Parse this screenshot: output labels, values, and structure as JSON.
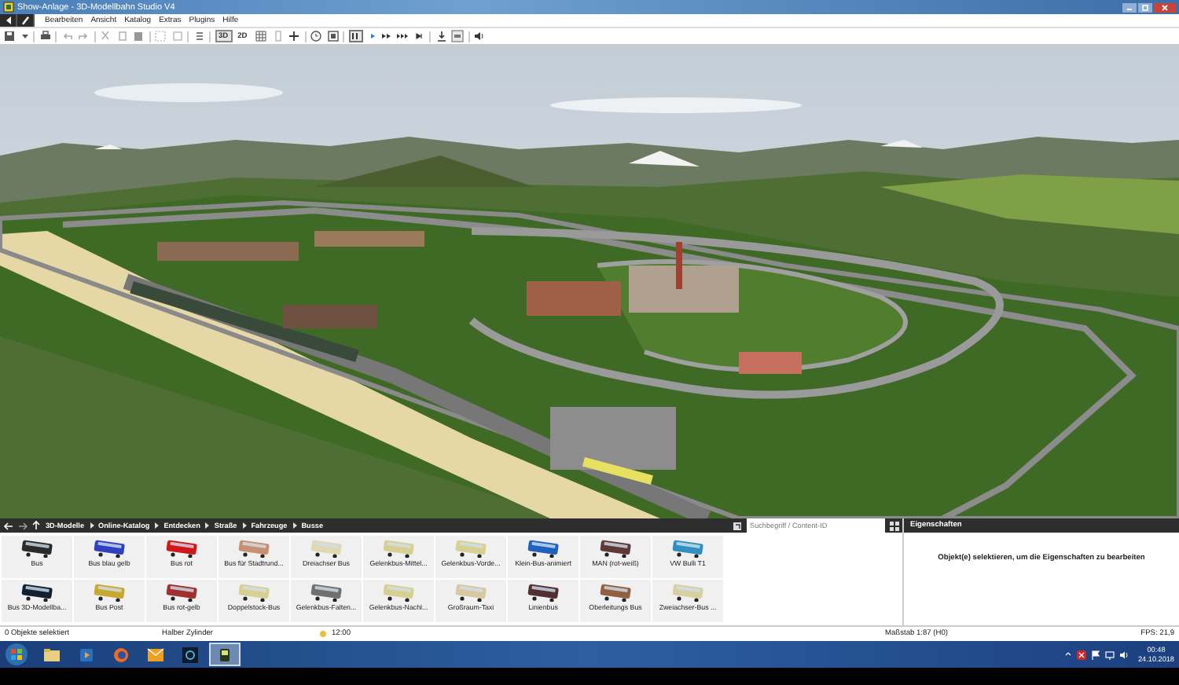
{
  "window": {
    "title": "Show-Anlage - 3D-Modellbahn Studio V4"
  },
  "menu": [
    "Bearbeiten",
    "Ansicht",
    "Katalog",
    "Extras",
    "Plugins",
    "Hilfe"
  ],
  "toolbar": {
    "view_modes": [
      {
        "label": "3D",
        "selected": true
      },
      {
        "label": "2D",
        "selected": false
      }
    ],
    "paused": true
  },
  "catalog": {
    "breadcrumb": [
      "3D-Modelle",
      "Online-Katalog",
      "Entdecken",
      "Straße",
      "Fahrzeuge",
      "Busse"
    ],
    "search": {
      "placeholder": "Suchbegriff / Content-ID"
    },
    "items": [
      {
        "label": "Bus",
        "color": "#2a2a2a"
      },
      {
        "label": "Bus blau gelb",
        "color": "#3040c0"
      },
      {
        "label": "Bus rot",
        "color": "#d01818"
      },
      {
        "label": "Bus für Stadtrund...",
        "color": "#c89070"
      },
      {
        "label": "Dreiachser Bus",
        "color": "#e0d8b0"
      },
      {
        "label": "Gelenkbus-Mittel...",
        "color": "#d8d090"
      },
      {
        "label": "Gelenkbus-Vorde...",
        "color": "#d8d090"
      },
      {
        "label": "Klein-Bus-animiert",
        "color": "#2060c0"
      },
      {
        "label": "MAN (rot-weiß)",
        "color": "#603838"
      },
      {
        "label": "VW Bulli T1",
        "color": "#3090c0"
      },
      {
        "label": "Bus 3D-Modellba...",
        "color": "#102030"
      },
      {
        "label": "Bus Post",
        "color": "#c8a830"
      },
      {
        "label": "Bus rot-gelb",
        "color": "#a03030"
      },
      {
        "label": "Doppelstock-Bus",
        "color": "#d8d090"
      },
      {
        "label": "Gelenkbus-Falten...",
        "color": "#707070"
      },
      {
        "label": "Gelenkbus-Nachl...",
        "color": "#d8d090"
      },
      {
        "label": "Großraum-Taxi",
        "color": "#d8c8a0"
      },
      {
        "label": "Linienbus",
        "color": "#503030"
      },
      {
        "label": "Oberleitungs Bus",
        "color": "#906040"
      },
      {
        "label": "Zweiachser-Bus ...",
        "color": "#d8d0a0"
      }
    ]
  },
  "properties": {
    "title": "Eigenschaften",
    "message": "Objekt(e) selektieren, um die Eigenschaften zu bearbeiten"
  },
  "status_bar": {
    "selection": "0 Objekte selektiert",
    "tool": "Halber Zylinder",
    "time": "12:00",
    "scale": "Maßstab 1:87 (H0)",
    "fps": "FPS: 21,9"
  },
  "taskbar": {
    "apps": [
      {
        "selected": false
      },
      {
        "selected": false
      },
      {
        "selected": false
      },
      {
        "selected": false
      },
      {
        "selected": false
      },
      {
        "selected": true
      }
    ],
    "clock": "00:48",
    "date": "24.10.2018"
  }
}
